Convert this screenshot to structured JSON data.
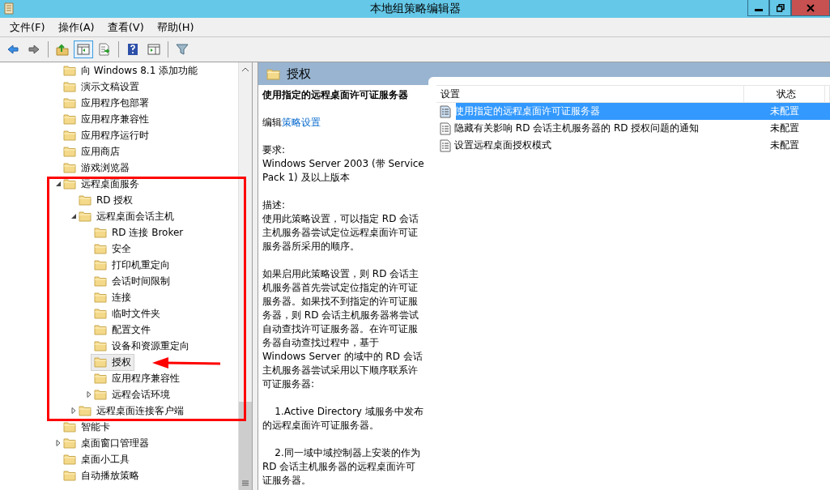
{
  "window": {
    "title": "本地组策略编辑器"
  },
  "menu": [
    "文件(F)",
    "操作(A)",
    "查看(V)",
    "帮助(H)"
  ],
  "toolbar": [
    {
      "kind": "back",
      "pressed": false
    },
    {
      "kind": "forward",
      "pressed": false
    },
    {
      "kind": "sep"
    },
    {
      "kind": "up",
      "pressed": false
    },
    {
      "kind": "tree",
      "pressed": true
    },
    {
      "kind": "export",
      "pressed": false
    },
    {
      "kind": "sep"
    },
    {
      "kind": "help",
      "pressed": false
    },
    {
      "kind": "pane",
      "pressed": false
    },
    {
      "kind": "sep"
    },
    {
      "kind": "filter",
      "pressed": false
    }
  ],
  "tree": {
    "items": [
      {
        "label": "向 Windows 8.1 添加功能",
        "selected": false
      },
      {
        "label": "演示文稿设置",
        "selected": false
      },
      {
        "label": "应用程序包部署",
        "selected": false
      },
      {
        "label": "应用程序兼容性",
        "selected": false
      },
      {
        "label": "应用程序运行时",
        "selected": false
      },
      {
        "label": "应用商店",
        "selected": false
      },
      {
        "label": "游戏浏览器",
        "selected": false
      },
      {
        "label": "远程桌面服务",
        "selected": false,
        "expanded": true,
        "children": [
          {
            "label": "RD 授权",
            "selected": false
          },
          {
            "label": "远程桌面会话主机",
            "selected": false,
            "expanded": true,
            "children": [
              {
                "label": "RD 连接 Broker",
                "selected": false
              },
              {
                "label": "安全",
                "selected": false
              },
              {
                "label": "打印机重定向",
                "selected": false
              },
              {
                "label": "会话时间限制",
                "selected": false
              },
              {
                "label": "连接",
                "selected": false
              },
              {
                "label": "临时文件夹",
                "selected": false
              },
              {
                "label": "配置文件",
                "selected": false
              },
              {
                "label": "设备和资源重定向",
                "selected": false
              },
              {
                "label": "授权",
                "selected": true
              },
              {
                "label": "应用程序兼容性",
                "selected": false
              },
              {
                "label": "远程会话环境",
                "selected": false,
                "expanded": false
              }
            ]
          },
          {
            "label": "远程桌面连接客户端",
            "selected": false,
            "expanded": false
          }
        ]
      },
      {
        "label": "智能卡",
        "selected": false
      },
      {
        "label": "桌面窗口管理器",
        "selected": false,
        "expanded": false
      },
      {
        "label": "桌面小工具",
        "selected": false
      },
      {
        "label": "自动播放策略",
        "selected": false
      }
    ]
  },
  "detail": {
    "heading": "授权",
    "title": "使用指定的远程桌面许可证服务器",
    "edit_prefix": "编辑",
    "edit_link": "策略设置",
    "paragraphs": [
      [
        "要求:",
        "Windows Server 2003 (带 Service Pack 1) 及以上版本"
      ],
      [
        "描述:",
        "使用此策略设置，可以指定 RD 会话主机服务器尝试定位远程桌面许可证服务器所采用的顺序。"
      ],
      [
        "如果启用此策略设置，则 RD 会话主机服务器首先尝试定位指定的许可证服务器。如果找不到指定的许可证服务器，则 RD 会话主机服务器将尝试自动查找许可证服务器。在许可证服务器自动查找过程中，基于 Windows Server 的域中的 RD 会话主机服务器尝试采用以下顺序联系许可证服务器:"
      ],
      [
        "    1.Active Directory 域服务中发布的远程桌面许可证服务器。"
      ],
      [
        "    2.同一域中域控制器上安装的作为 RD 会话主机服务器的远程桌面许可证服务器。"
      ]
    ]
  },
  "settings": {
    "columns": [
      "设置",
      "状态"
    ],
    "rows": [
      {
        "name": "使用指定的远程桌面许可证服务器",
        "state": "未配置",
        "selected": true
      },
      {
        "name": "隐藏有关影响 RD 会话主机服务器的 RD 授权问题的通知",
        "state": "未配置",
        "selected": false
      },
      {
        "name": "设置远程桌面授权模式",
        "state": "未配置",
        "selected": false
      }
    ]
  }
}
